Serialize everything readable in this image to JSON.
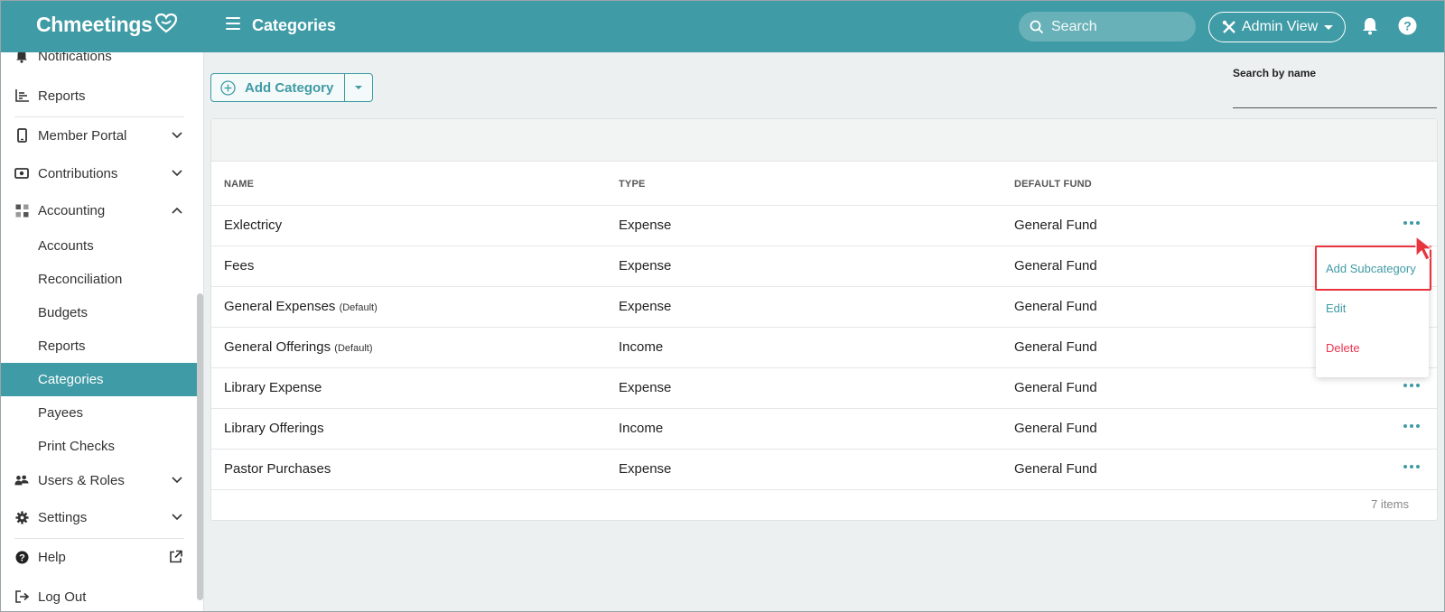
{
  "header": {
    "logo": "Chmeetings",
    "page_title": "Categories",
    "search_placeholder": "Search",
    "admin_view_label": "Admin View",
    "colors": {
      "brand": "#3f9ba5",
      "danger": "#e8344f"
    }
  },
  "sidebar": {
    "items": [
      {
        "label": "Notifications",
        "icon": "bell-icon"
      },
      {
        "label": "Reports",
        "icon": "chart-icon"
      },
      {
        "label": "Member Portal",
        "icon": "phone-icon"
      },
      {
        "label": "Contributions",
        "icon": "money-icon"
      },
      {
        "label": "Accounting",
        "icon": "grid-icon"
      },
      {
        "label": "Users & Roles",
        "icon": "users-icon"
      },
      {
        "label": "Settings",
        "icon": "gear-icon"
      },
      {
        "label": "Help",
        "icon": "help-icon"
      },
      {
        "label": "Log Out",
        "icon": "logout-icon"
      }
    ],
    "accounting_sub": [
      "Accounts",
      "Reconciliation",
      "Budgets",
      "Reports",
      "Categories",
      "Payees",
      "Print Checks"
    ],
    "active_item": "Categories"
  },
  "toolbar": {
    "add_category_label": "Add Category",
    "search_by_name_label": "Search by name",
    "search_by_name_value": ""
  },
  "table": {
    "columns": [
      "NAME",
      "TYPE",
      "DEFAULT FUND"
    ],
    "rows": [
      {
        "name": "Exlectricy",
        "note": "",
        "type": "Expense",
        "fund": "General Fund"
      },
      {
        "name": "Fees",
        "note": "",
        "type": "Expense",
        "fund": "General Fund"
      },
      {
        "name": "General Expenses",
        "note": "(Default)",
        "type": "Expense",
        "fund": "General Fund"
      },
      {
        "name": "General Offerings",
        "note": "(Default)",
        "type": "Income",
        "fund": "General Fund"
      },
      {
        "name": "Library Expense",
        "note": "",
        "type": "Expense",
        "fund": "General Fund"
      },
      {
        "name": "Library Offerings",
        "note": "",
        "type": "Income",
        "fund": "General Fund"
      },
      {
        "name": "Pastor Purchases",
        "note": "",
        "type": "Expense",
        "fund": "General Fund"
      }
    ],
    "footer": "7 items"
  },
  "row_menu": {
    "items": [
      "Add Subcategory",
      "Edit",
      "Delete"
    ]
  }
}
